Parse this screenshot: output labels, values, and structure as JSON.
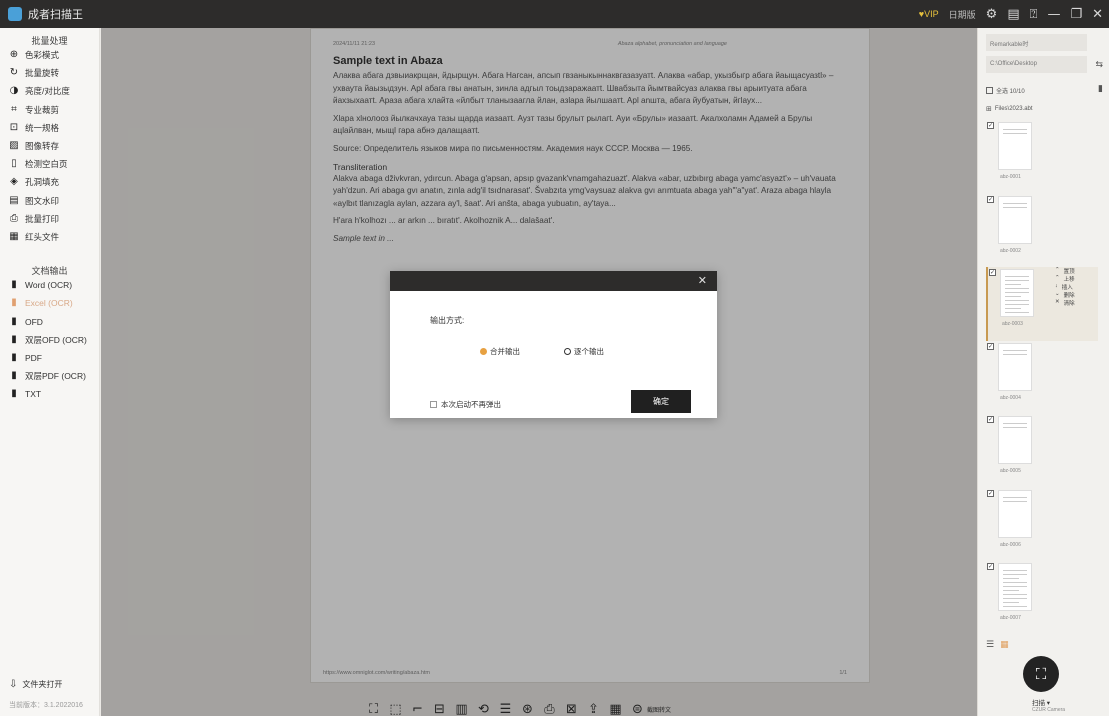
{
  "app": {
    "title": "成者扫描王",
    "vip_label": "♥VIP",
    "vip_sub": "日期版"
  },
  "sidebar": {
    "section1_title": "批量处理",
    "section1_items": [
      {
        "label": "色彩模式",
        "icon": "palette-icon"
      },
      {
        "label": "批量旋转",
        "icon": "rotate-icon"
      },
      {
        "label": "亮度/对比度",
        "icon": "contrast-icon"
      },
      {
        "label": "专业裁剪",
        "icon": "crop-icon"
      },
      {
        "label": "统一规格",
        "icon": "resize-icon"
      },
      {
        "label": "图像转存",
        "icon": "image-save-icon"
      },
      {
        "label": "检测空白页",
        "icon": "blank-page-icon"
      },
      {
        "label": "孔洞填充",
        "icon": "fill-icon"
      },
      {
        "label": "图文水印",
        "icon": "watermark-icon"
      },
      {
        "label": "批量打印",
        "icon": "print-icon"
      },
      {
        "label": "红头文件",
        "icon": "red-header-icon"
      }
    ],
    "section2_title": "文档输出",
    "section2_items": [
      {
        "label": "Word (OCR)",
        "icon": "word-icon",
        "disabled": false
      },
      {
        "label": "Excel (OCR)",
        "icon": "excel-icon",
        "disabled": true
      },
      {
        "label": "OFD",
        "icon": "ofd-icon",
        "disabled": false
      },
      {
        "label": "双层OFD (OCR)",
        "icon": "ofd-layer-icon",
        "disabled": false
      },
      {
        "label": "PDF",
        "icon": "pdf-icon",
        "disabled": false
      },
      {
        "label": "双层PDF (OCR)",
        "icon": "pdf-layer-icon",
        "disabled": false
      },
      {
        "label": "TXT",
        "icon": "txt-icon",
        "disabled": false
      }
    ],
    "open_folder": "文件夹打开",
    "version": "当前版本：3.1.2022016"
  },
  "document": {
    "header_left": "2024/11/11 21:23",
    "header_right": "Abaza alphabet, pronunciation and language",
    "heading": "Sample text in Abaza",
    "para1": "Алаква абага дзвыиакрщан, йдырщун. Абага Нагсан, апсып гвзаныкыннаквгазазуатt. Алаква «абар, укызбыгр абага йаыщасуазtl» – ухваута йаызыдзун. Apl абага гвы анатын, зинла адгыл тоыдзаражаатt. Швабзыта йымтвайсуаз алаква гвы арыитуата абага йахзыхаатt. Араза абага хлайта «йлбыт тланызаагла йлан, азlара йылшаатt. Apl anшта, абага йубуатын, йгlayх...",
    "para2": "Хlapa хlнолооз йылкачхауа тазы щарда иазаатt. Аузт тазы брулыт рылагt. Ауи «Брулы» иазаатt. Акалхоламн Адамей а Брулы ацlайлван, мыщl гара абнэ далащаатt.",
    "source": "Source: Определитель языков мира по письменностям. Академия наук СССР. Москва — 1965.",
    "translit_title": "Transliteration",
    "translit": "Alakva abaga dživkvran, ydırcun. Abaga g'apsan, apsıp gvazank'vnamgahazuazt'. Alakva «abar, uzbıbırg abaga yamc'asyazt'» – uh'vauata yah'dzun. Ari abaga gvı anatın, zınla adg'il tsıdnarasat'. Švabzıta ymg'vaysuaz alakva gvı arımtuata abaga yah'\"a\"yat'. Araza abaga hlayla «aylbıt tlanızagla aylan, azzara ay'l, šaat'. Ari anšta, abaga yubuatın, ay'taya...",
    "translit2": "H'ara h'kolhozı ... ar arkın ... bıratıt'. Akolhoznik A... dalašaat'.",
    "sample_note": "Sample text in ...",
    "footer_left": "https://www.omniglot.com/writing/abaza.htm",
    "footer_right": "1/1"
  },
  "dialog": {
    "close": "✕",
    "output_label": "输出方式:",
    "option_merge": "合并输出",
    "option_single": "逐个输出",
    "selected": "merge",
    "no_popup": "本次启动不再弹出",
    "confirm": "确定"
  },
  "toolbar": {
    "items": [
      "crop-icon",
      "select-icon",
      "cut-icon",
      "ocr-icon",
      "scan-icon",
      "rotate-icon",
      "align-icon",
      "color-icon",
      "print-icon",
      "compress-icon",
      "export-icon",
      "barcode-icon"
    ],
    "more_label": "截图转文"
  },
  "rpanel": {
    "field1": "Remarkable时",
    "field2": "C:\\Office\\Desktop",
    "select_all": "全选  10/10",
    "folder": "Files\\2023.abt",
    "thumbs": [
      {
        "name": "abz-0001",
        "selected": false
      },
      {
        "name": "abz-0002",
        "selected": false
      },
      {
        "name": "abz-0003",
        "selected": true
      },
      {
        "name": "abz-0004",
        "selected": false
      },
      {
        "name": "abz-0005",
        "selected": false
      },
      {
        "name": "abz-0006",
        "selected": false
      },
      {
        "name": "abz-0007",
        "selected": false
      }
    ],
    "side_menu": [
      "置顶",
      "上移",
      "插入",
      "删除",
      "清除"
    ],
    "scan_label": "扫描 ▾",
    "scan_sub": "CZUR Camera"
  }
}
